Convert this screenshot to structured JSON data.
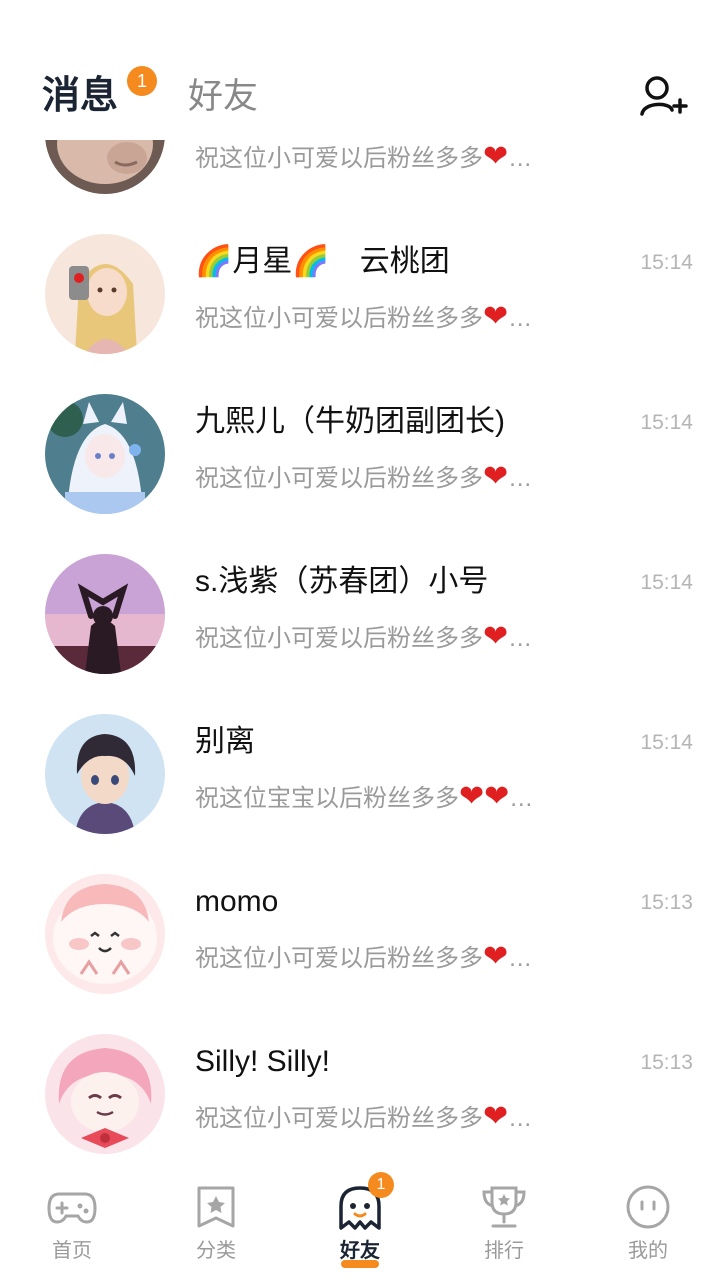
{
  "header": {
    "tab_messages": "消息",
    "tab_messages_badge": "1",
    "tab_friends": "好友"
  },
  "messages": [
    {
      "name": "",
      "time": "",
      "preview": "祝这位小可爱以后粉丝多多",
      "hearts": "❤",
      "ellipsis": "…"
    },
    {
      "name": "🌈月星🌈　云桃团",
      "time": "15:14",
      "preview": "祝这位小可爱以后粉丝多多",
      "hearts": "❤",
      "ellipsis": "…"
    },
    {
      "name": "九熙儿（牛奶团副团长)",
      "time": "15:14",
      "preview": "祝这位小可爱以后粉丝多多",
      "hearts": "❤",
      "ellipsis": "…"
    },
    {
      "name": "s.浅紫（苏春团）小号",
      "time": "15:14",
      "preview": "祝这位小可爱以后粉丝多多",
      "hearts": "❤",
      "ellipsis": "…"
    },
    {
      "name": "别离",
      "time": "15:14",
      "preview": "祝这位宝宝以后粉丝多多",
      "hearts": "❤❤",
      "ellipsis": "…"
    },
    {
      "name": "momo",
      "time": "15:13",
      "preview": "祝这位小可爱以后粉丝多多",
      "hearts": "❤",
      "ellipsis": "…"
    },
    {
      "name": "Silly! Silly!",
      "time": "15:13",
      "preview": "祝这位小可爱以后粉丝多多",
      "hearts": "❤",
      "ellipsis": "…"
    }
  ],
  "nav": {
    "home": "首页",
    "category": "分类",
    "friends": "好友",
    "friends_badge": "1",
    "ranking": "排行",
    "mine": "我的"
  },
  "colors": {
    "accent": "#f58a1f",
    "heart": "#e02020",
    "title": "#1b2433"
  }
}
